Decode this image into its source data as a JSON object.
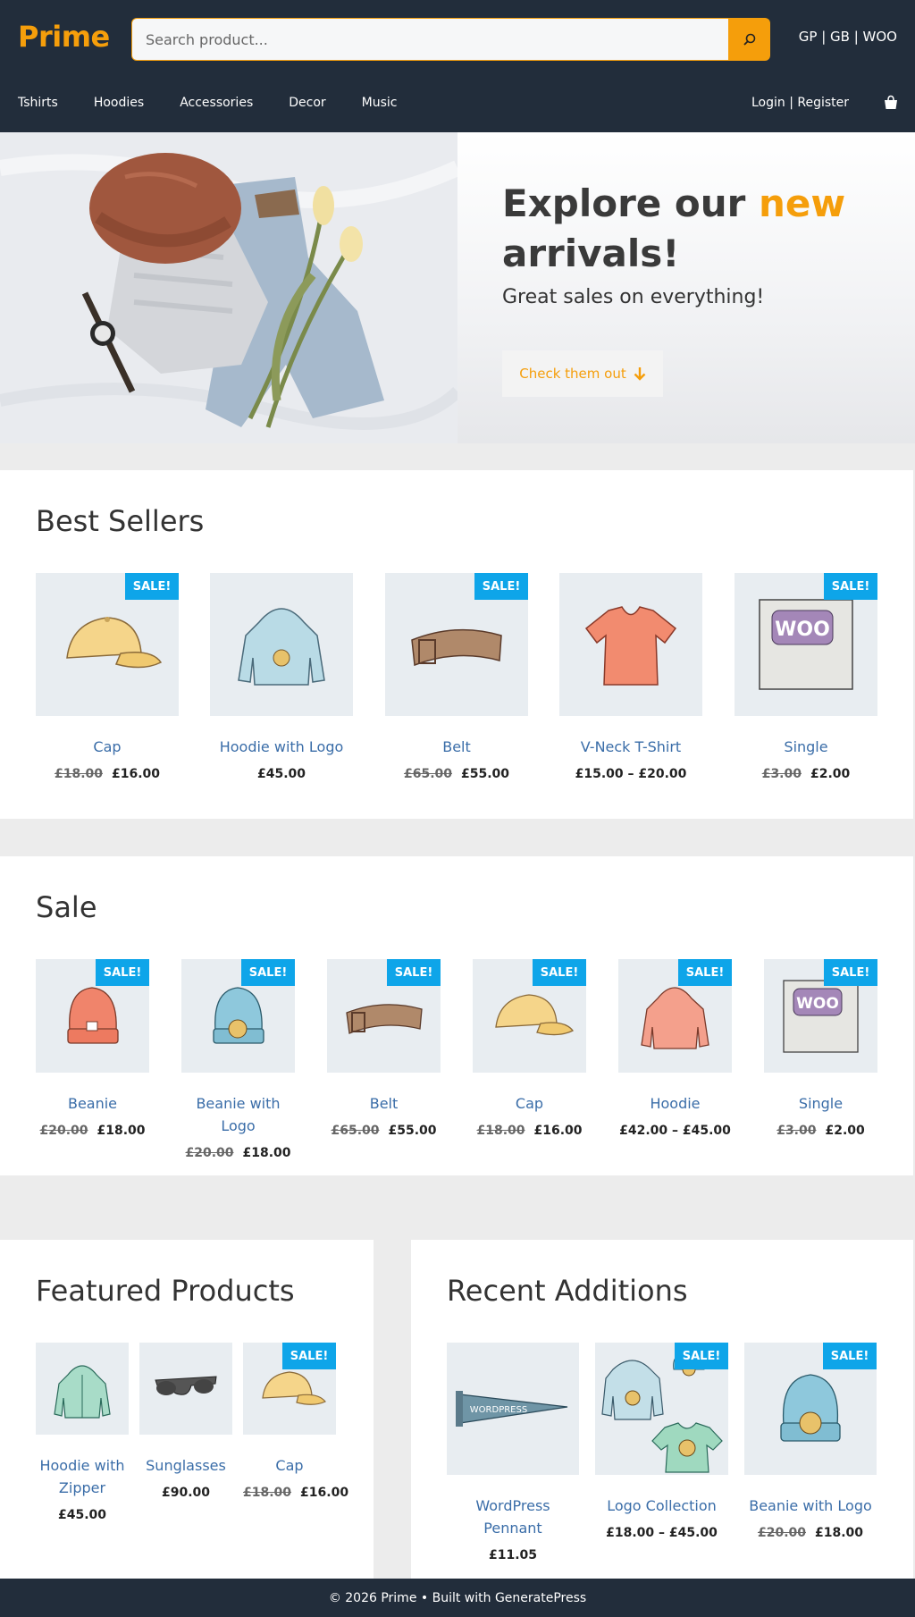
{
  "header": {
    "logo": "Prime",
    "search_placeholder": "Search product...",
    "top_links": "GP | GB | WOO",
    "nav": [
      "Tshirts",
      "Hoodies",
      "Accessories",
      "Decor",
      "Music"
    ],
    "account": "Login | Register"
  },
  "hero": {
    "title_part1": "Explore our ",
    "title_accent": "new",
    "title_part2": "arrivals!",
    "subtitle": "Great sales on everything!",
    "button_label": "Check them out"
  },
  "best_sellers": {
    "title": "Best Sellers",
    "items": [
      {
        "name": "Cap",
        "old_price": "£18.00",
        "price": "£16.00",
        "sale": "SALE!"
      },
      {
        "name": "Hoodie with Logo",
        "old_price": "",
        "price": "£45.00",
        "sale": ""
      },
      {
        "name": "Belt",
        "old_price": "£65.00",
        "price": "£55.00",
        "sale": "SALE!"
      },
      {
        "name": "V-Neck T-Shirt",
        "old_price": "",
        "price": "£15.00 – £20.00",
        "sale": ""
      },
      {
        "name": "Single",
        "old_price": "£3.00",
        "price": "£2.00",
        "sale": "SALE!"
      }
    ]
  },
  "sale": {
    "title": "Sale",
    "items": [
      {
        "name": "Beanie",
        "old_price": "£20.00",
        "price": "£18.00",
        "sale": "SALE!"
      },
      {
        "name": "Beanie with Logo",
        "old_price": "£20.00",
        "price": "£18.00",
        "sale": "SALE!"
      },
      {
        "name": "Belt",
        "old_price": "£65.00",
        "price": "£55.00",
        "sale": "SALE!"
      },
      {
        "name": "Cap",
        "old_price": "£18.00",
        "price": "£16.00",
        "sale": "SALE!"
      },
      {
        "name": "Hoodie",
        "old_price": "",
        "price": "£42.00 – £45.00",
        "sale": "SALE!"
      },
      {
        "name": "Single",
        "old_price": "£3.00",
        "price": "£2.00",
        "sale": "SALE!"
      }
    ]
  },
  "featured": {
    "title": "Featured Products",
    "items": [
      {
        "name": "Hoodie with Zipper",
        "old_price": "",
        "price": "£45.00",
        "sale": ""
      },
      {
        "name": "Sunglasses",
        "old_price": "",
        "price": "£90.00",
        "sale": ""
      },
      {
        "name": "Cap",
        "old_price": "£18.00",
        "price": "£16.00",
        "sale": "SALE!"
      }
    ]
  },
  "recent": {
    "title": "Recent Additions",
    "items": [
      {
        "name": "WordPress Pennant",
        "old_price": "",
        "price": "£11.05",
        "sale": ""
      },
      {
        "name": "Logo Collection",
        "old_price": "",
        "price": "£18.00 – £45.00",
        "sale": "SALE!"
      },
      {
        "name": "Beanie with Logo",
        "old_price": "£20.00",
        "price": "£18.00",
        "sale": "SALE!"
      }
    ]
  },
  "footer": {
    "text": "© 2026 Prime • Built with GeneratePress"
  },
  "colors": {
    "header_bg": "#222d3b",
    "accent": "#f59e0b",
    "sale_badge": "#0ea5e9",
    "link": "#3a6da8"
  },
  "icons": [
    "search-icon",
    "cart-icon",
    "arrow-down-icon"
  ]
}
